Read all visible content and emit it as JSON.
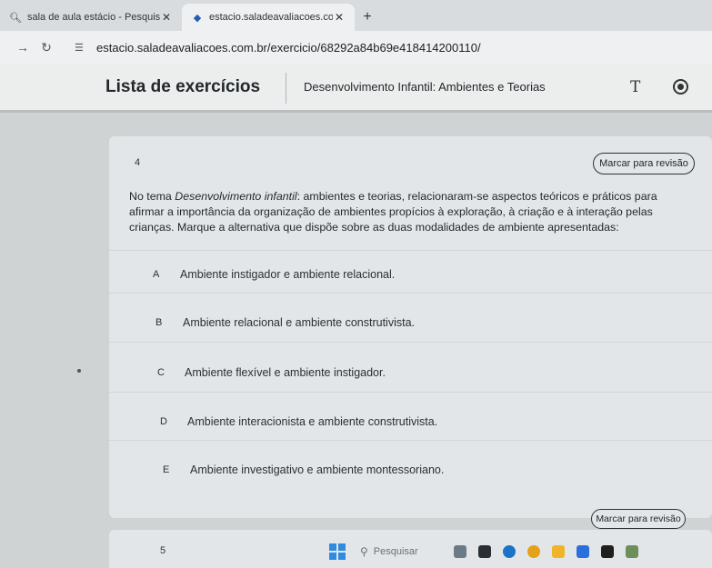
{
  "browser": {
    "tabs": [
      {
        "icon": "search-icon",
        "title": "sala de aula estácio - Pesquisar",
        "close": "✕"
      },
      {
        "icon": "site-diamond-icon",
        "title": "estacio.saladeavaliacoes.com.br",
        "close": "✕"
      }
    ],
    "new_tab": "+",
    "url": "estacio.saladeavaliacoes.com.br/exercicio/68292a84b69e418414200110/"
  },
  "header": {
    "title": "Lista de exercícios",
    "subject": "Desenvolvimento Infantil: Ambientes e Teorias",
    "font_icon_glyph": "T"
  },
  "question": {
    "number": "4",
    "review_label": "Marcar para revisão",
    "text_prefix": "No tema ",
    "text_italic": "Desenvolvimento infantil",
    "text_rest": ": ambientes e teorias, relacionaram-se aspectos teóricos e práticos para afirmar a importância da organização de ambientes propícios à exploração, à criação e à interação pelas crianças. Marque a alternativa que dispõe sobre as duas modalidades de ambiente apresentadas:",
    "options": [
      {
        "letter": "A",
        "text": "Ambiente instigador e ambiente relacional."
      },
      {
        "letter": "B",
        "text": "Ambiente relacional e ambiente construtivista."
      },
      {
        "letter": "C",
        "text": "Ambiente flexível e ambiente instigador."
      },
      {
        "letter": "D",
        "text": "Ambiente interacionista e ambiente construtivista."
      },
      {
        "letter": "E",
        "text": "Ambiente investigativo e ambiente montessoriano."
      }
    ]
  },
  "next_question": {
    "number": "5",
    "review_label": "Marcar para revisão"
  },
  "taskbar": {
    "search_placeholder": "Pesquisar"
  },
  "colors": {
    "page_bg": "#cfd3d4",
    "card_bg": "#e3e6e8",
    "windows_blue": "#2f8be0"
  }
}
